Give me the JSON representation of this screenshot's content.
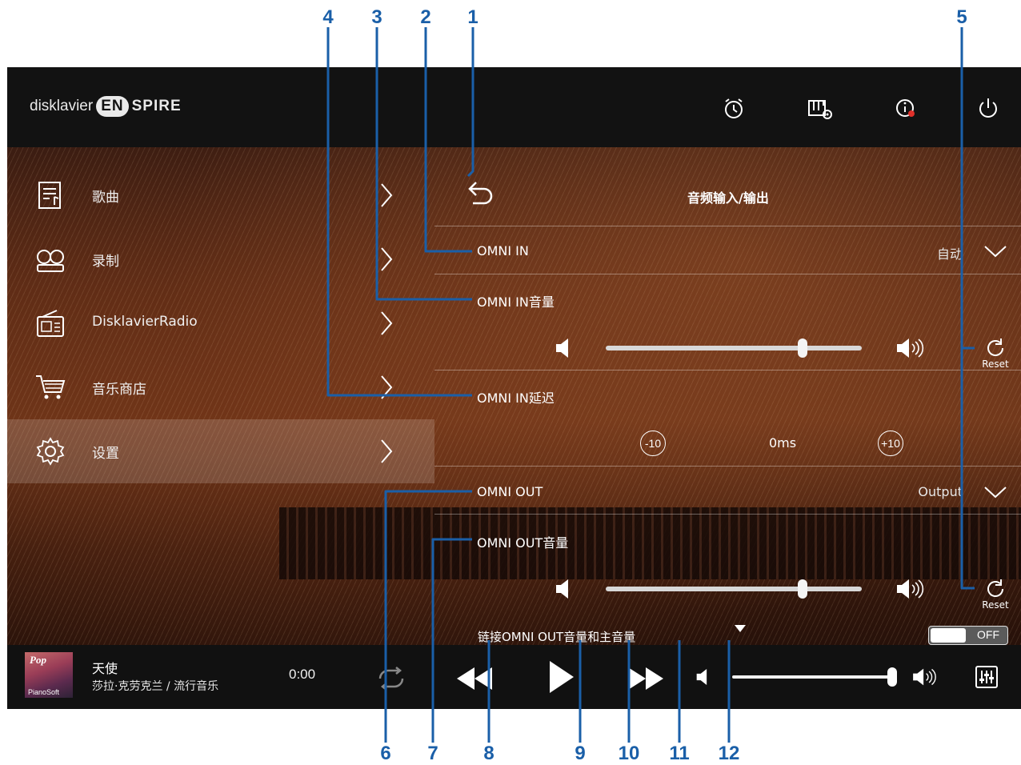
{
  "callouts": [
    "1",
    "2",
    "3",
    "4",
    "5",
    "6",
    "7",
    "8",
    "9",
    "10",
    "11",
    "12"
  ],
  "app": {
    "logo_prefix": "disklavier",
    "logo_en": "EN",
    "logo_suffix": "SPIRE",
    "topbar_icons": [
      "alarm-clock-icon",
      "piano-settings-icon",
      "info-icon",
      "power-icon"
    ]
  },
  "menu": {
    "items": [
      {
        "label": "歌曲",
        "icon": "song-icon"
      },
      {
        "label": "录制",
        "icon": "record-icon"
      },
      {
        "label": "DisklavierRadio",
        "icon": "radio-icon"
      },
      {
        "label": "音乐商店",
        "icon": "cart-icon"
      },
      {
        "label": "设置",
        "icon": "gear-icon",
        "selected": true
      }
    ]
  },
  "panel": {
    "title": "音频输入/输出",
    "omni_in_label": "OMNI IN",
    "omni_in_value": "自动",
    "omni_in_volume_label": "OMNI IN音量",
    "omni_in_volume_level": 0.77,
    "reset_label": "Reset",
    "omni_in_delay_label": "OMNI IN延迟",
    "delay_minus": "-10",
    "delay_value": "0ms",
    "delay_plus": "+10",
    "omni_out_label": "OMNI OUT",
    "omni_out_value": "Output",
    "omni_out_volume_label": "OMNI OUT音量",
    "omni_out_volume_level": 0.77,
    "link_label": "链接OMNI OUT音量和主音量",
    "link_toggle": "OFF"
  },
  "player": {
    "art_genre": "Pop",
    "art_brand": "PianoSoft",
    "song_title": "天使",
    "song_artist": "莎拉·克劳克兰 / 流行音乐",
    "time": "0:00",
    "master_volume_level": 0.97
  },
  "colors": {
    "callout": "#1a5fa8",
    "topbar": "#121212",
    "player": "#111111"
  }
}
